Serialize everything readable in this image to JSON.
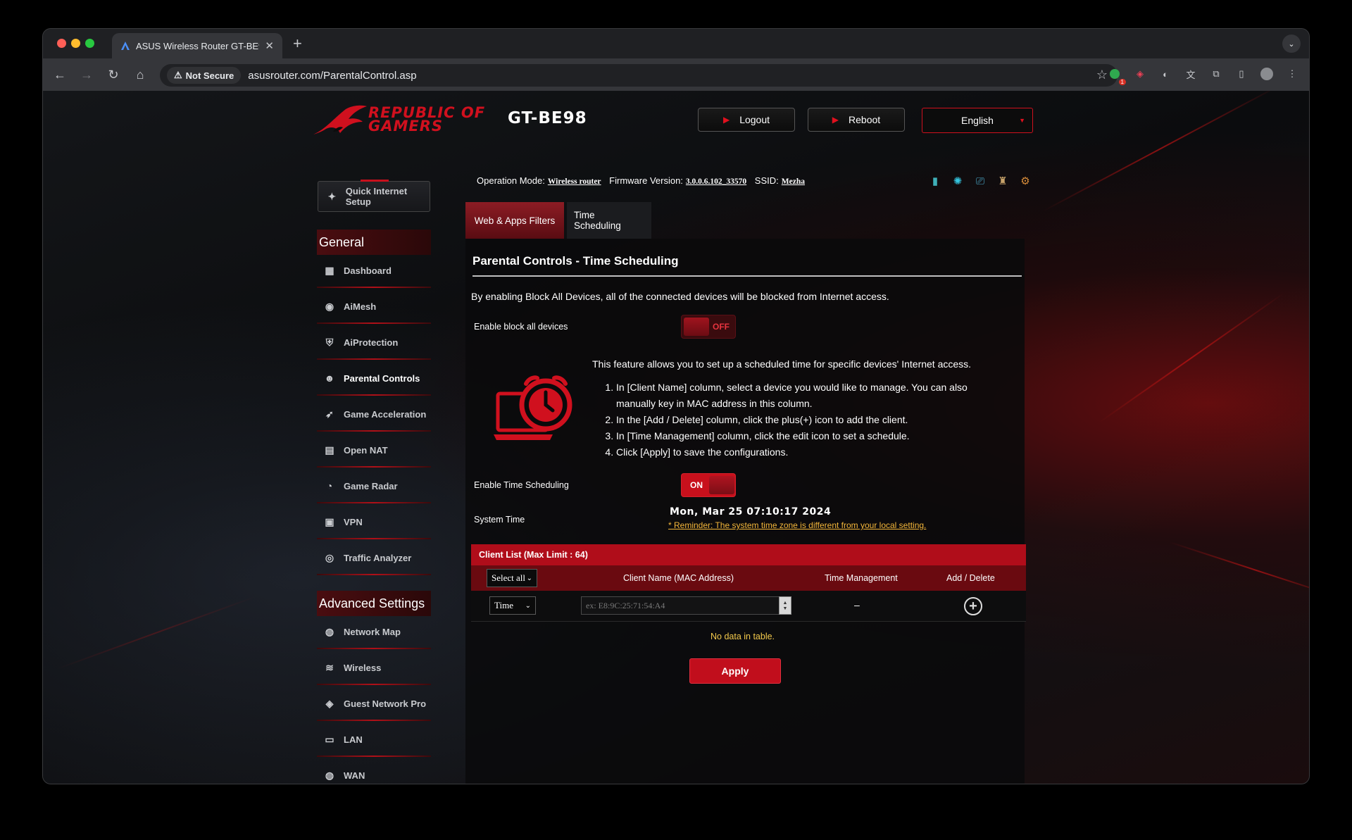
{
  "browser": {
    "tab_title": "ASUS Wireless Router GT-BE98",
    "tab_close": "✕",
    "new_tab": "+",
    "security_chip": "Not Secure",
    "url": "asusrouter.com/ParentalControl.asp",
    "extension_badge": "1"
  },
  "header": {
    "brand_line1": "REPUBLIC OF",
    "brand_line2": "GAMERS",
    "model": "GT-BE98",
    "logout": "Logout",
    "reboot": "Reboot",
    "language": "English"
  },
  "sidebar": {
    "quick_setup": "Quick Internet Setup",
    "general_heading": "General",
    "general_items": [
      {
        "label": "Dashboard",
        "icon": "dashboard-icon"
      },
      {
        "label": "AiMesh",
        "icon": "aimesh-icon"
      },
      {
        "label": "AiProtection",
        "icon": "shield-icon"
      },
      {
        "label": "Parental Controls",
        "icon": "family-icon",
        "active": true
      },
      {
        "label": "Game Acceleration",
        "icon": "rocket-icon"
      },
      {
        "label": "Open NAT",
        "icon": "nat-icon"
      },
      {
        "label": "Game Radar",
        "icon": "radar-icon"
      },
      {
        "label": "VPN",
        "icon": "vpn-icon"
      },
      {
        "label": "Traffic Analyzer",
        "icon": "analyzer-icon"
      }
    ],
    "advanced_heading": "Advanced Settings",
    "advanced_items": [
      {
        "label": "Network Map",
        "icon": "globe-icon"
      },
      {
        "label": "Wireless",
        "icon": "wifi-icon"
      },
      {
        "label": "Guest Network Pro",
        "icon": "guest-network-icon"
      },
      {
        "label": "LAN",
        "icon": "lan-icon"
      },
      {
        "label": "WAN",
        "icon": "wan-icon"
      }
    ]
  },
  "status": {
    "op_mode_label": "Operation Mode:",
    "op_mode_value": "Wireless router",
    "fw_label": "Firmware Version:",
    "fw_value": "3.0.0.6.102_33570",
    "ssid_label": "SSID:",
    "ssid_value": "Mezha"
  },
  "tabs": {
    "web_apps": "Web & Apps Filters",
    "time_scheduling": "Time Scheduling"
  },
  "main": {
    "title": "Parental Controls - Time Scheduling",
    "block_desc": "By enabling Block All Devices, all of the connected devices will be blocked from Internet access.",
    "block_label": "Enable block all devices",
    "block_state": "OFF",
    "feature_desc": "This feature allows you to set up a scheduled time for specific devices' Internet access.",
    "steps": [
      "In [Client Name] column, select a device you would like to manage. You can also manually key in MAC address in this column.",
      "In the [Add / Delete] column, click the plus(+) icon to add the client.",
      "In [Time Management] column, click the edit icon to set a schedule.",
      "Click [Apply] to save the configurations."
    ],
    "sched_label": "Enable Time Scheduling",
    "sched_state": "ON",
    "systime_label": "System Time",
    "systime_value": "Mon, Mar 25 07:10:17 2024",
    "reminder": "* Reminder: The system time zone is different from your local setting."
  },
  "client_list": {
    "heading": "Client List (Max Limit : 64)",
    "select_all": "Select all",
    "col_client": "Client Name (MAC Address)",
    "col_time": "Time Management",
    "col_add": "Add / Delete",
    "row_mode": "Time",
    "mac_placeholder": "ex: E8:9C:25:71:54:A4",
    "time_value": "–",
    "empty": "No data in table."
  },
  "apply": "Apply",
  "colors": {
    "accent": "#c10e1c",
    "warning": "#f3b63a"
  }
}
